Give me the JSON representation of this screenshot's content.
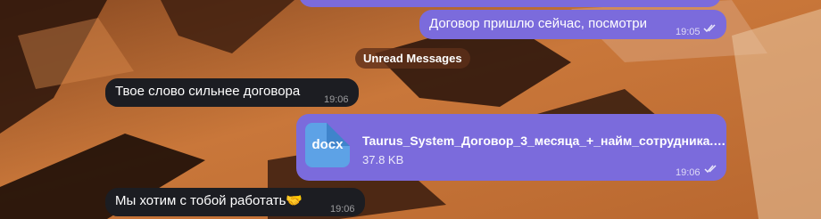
{
  "chat": {
    "messages": [
      {
        "text": "Договор пришлю сейчас, посмотри",
        "time": "19:05"
      },
      {
        "text": "Твое слово сильнее договора",
        "time": "19:06"
      },
      {
        "file_ext": "docx",
        "file_name": "Taurus_System_Договор_3_месяца_+_найм_сотрудника.docx",
        "file_size": "37.8 KB",
        "time": "19:06"
      },
      {
        "text": "Мы хотим с тобой работать",
        "emoji": "🤝",
        "time": "19:06"
      }
    ],
    "unread_divider": "Unread Messages"
  },
  "colors": {
    "outgoing": "#7b6bdc",
    "incoming": "#1c1d22",
    "wallpaper": "#b8682f"
  },
  "icons": {
    "read_receipt": "double-check-icon",
    "file": "document-icon",
    "handshake": "handshake-emoji"
  }
}
